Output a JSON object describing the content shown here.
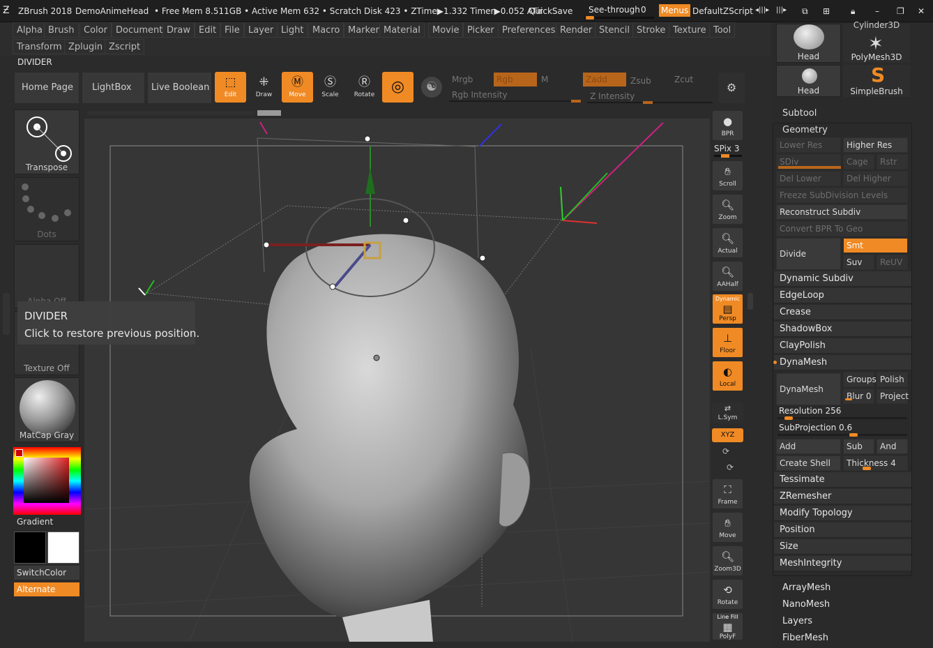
{
  "titlebar": {
    "app": "ZBrush 2018",
    "doc": "DemoAnimeHead",
    "stats": "• Free Mem 8.511GB • Active Mem 632 • Scratch Disk 423 • ZTime▶1.332 Timer▶0.052 ATir",
    "quicksave": "QuickSave",
    "seethrough": "See-through",
    "seethrough_val": "0",
    "menus": "Menus",
    "zscript": "DefaultZScript"
  },
  "menu": {
    "row1": [
      "Alpha",
      "Brush",
      "Color",
      "Document",
      "Draw",
      "Edit",
      "File",
      "Layer",
      "Light",
      "Macro",
      "Marker",
      "Material",
      "Movie",
      "Picker",
      "Preferences",
      "Render",
      "Stencil",
      "Stroke",
      "Texture",
      "Tool"
    ],
    "row2": [
      "Transform",
      "Zplugin",
      "Zscript"
    ]
  },
  "divider_label": "DIVIDER",
  "nav": {
    "home": "Home Page",
    "lightbox": "LightBox",
    "liveboolean": "Live Boolean"
  },
  "tools": {
    "edit": "Edit",
    "draw": "Draw",
    "move": "Move",
    "scale": "Scale",
    "rotate": "Rotate"
  },
  "channels": {
    "mrgb": "Mrgb",
    "rgb": "Rgb",
    "m": "M",
    "zadd": "Zadd",
    "zsub": "Zsub",
    "zcut": "Zcut",
    "rgb_int": "Rgb Intensity",
    "z_int": "Z Intensity"
  },
  "left": {
    "transpose": "Transpose",
    "dots": "Dots",
    "alpha": "Alpha Off",
    "texture": "Texture Off",
    "matcap": "MatCap Gray",
    "gradient": "Gradient",
    "switchcolor": "SwitchColor",
    "alternate": "Alternate"
  },
  "tooltip": {
    "title": "DIVIDER",
    "text": "Click to restore previous position."
  },
  "right": {
    "bpr": "BPR",
    "spix": "SPix 3",
    "scroll": "Scroll",
    "zoom": "Zoom",
    "actual": "Actual",
    "aahalf": "AAHalf",
    "persp_top": "Dynamic",
    "persp": "Persp",
    "floor": "Floor",
    "local": "Local",
    "lsym": "L.Sym",
    "xyz": "XYZ",
    "frame": "Frame",
    "move": "Move",
    "zoom3d": "Zoom3D",
    "rotate": "Rotate",
    "linefill": "Line Fill",
    "polyf": "PolyF"
  },
  "tray": {
    "thumbs": [
      "Cylinder3D",
      "Head",
      "PolyMesh3D",
      "Head",
      "SimpleBrush"
    ],
    "subtool": "Subtool",
    "geometry": "Geometry",
    "lowerres": "Lower Res",
    "higherres": "Higher Res",
    "sdiv": "SDiv",
    "cage": "Cage",
    "rstr": "Rstr",
    "dellower": "Del Lower",
    "delhigher": "Del Higher",
    "freeze": "Freeze SubDivision Levels",
    "reconstruct": "Reconstruct Subdiv",
    "convertbpr": "Convert BPR To Geo",
    "divide": "Divide",
    "smt": "Smt",
    "suv": "Suv",
    "reuv": "ReUV",
    "items1": [
      "Dynamic Subdiv",
      "EdgeLoop",
      "Crease",
      "ShadowBox",
      "ClayPolish",
      "DynaMesh"
    ],
    "dynamesh": "DynaMesh",
    "groups": "Groups",
    "polish": "Polish",
    "blur": "Blur 0",
    "project": "Project",
    "resolution": "Resolution 256",
    "subprojection": "SubProjection 0.6",
    "add": "Add",
    "sub": "Sub",
    "and": "And",
    "createshell": "Create Shell",
    "thickness": "Thickness 4",
    "items2": [
      "Tessimate",
      "ZRemesher",
      "Modify Topology",
      "Position",
      "Size",
      "MeshIntegrity"
    ],
    "items3": [
      "ArrayMesh",
      "NanoMesh",
      "Layers",
      "FiberMesh"
    ]
  }
}
